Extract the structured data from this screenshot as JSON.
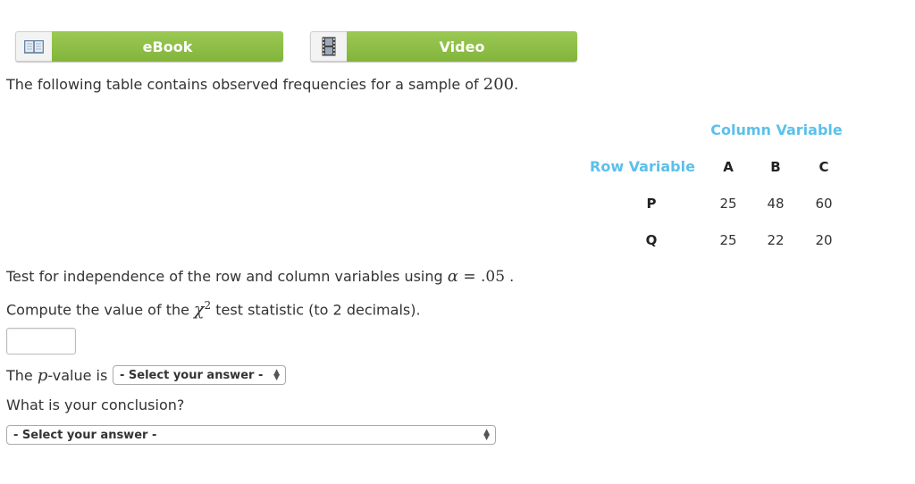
{
  "toolbar": {
    "ebook_label": "eBook",
    "video_label": "Video"
  },
  "intro": {
    "text": "The following table contains observed frequencies for a sample of ",
    "sample_size": "200",
    "end": "."
  },
  "table": {
    "column_header": "Column Variable",
    "row_header": "Row Variable",
    "columns": [
      "A",
      "B",
      "C"
    ],
    "rows": [
      {
        "label": "P",
        "values": [
          "25",
          "48",
          "60"
        ]
      },
      {
        "label": "Q",
        "values": [
          "25",
          "22",
          "20"
        ]
      }
    ]
  },
  "question": {
    "test_text": "Test for independence of the row and column variables using ",
    "alpha_symbol": "α",
    "alpha_eq": " = ",
    "alpha_value": ".05",
    "test_end": " .",
    "compute_text": "Compute the value of the ",
    "chi_symbol": "χ",
    "chi_exp": "2",
    "compute_end": " test statistic (to 2 decimals).",
    "pvalue_pre": "The ",
    "pvalue_p": "p",
    "pvalue_post": "-value is",
    "pvalue_select": "- Select your answer -",
    "conclusion_question": "What is your conclusion?",
    "conclusion_select": "- Select your answer -"
  },
  "colors": {
    "button_green": "#8bbd45",
    "table_header_blue": "#5bc0eb"
  },
  "icons": {
    "ebook": "book-icon",
    "video": "film-icon"
  }
}
